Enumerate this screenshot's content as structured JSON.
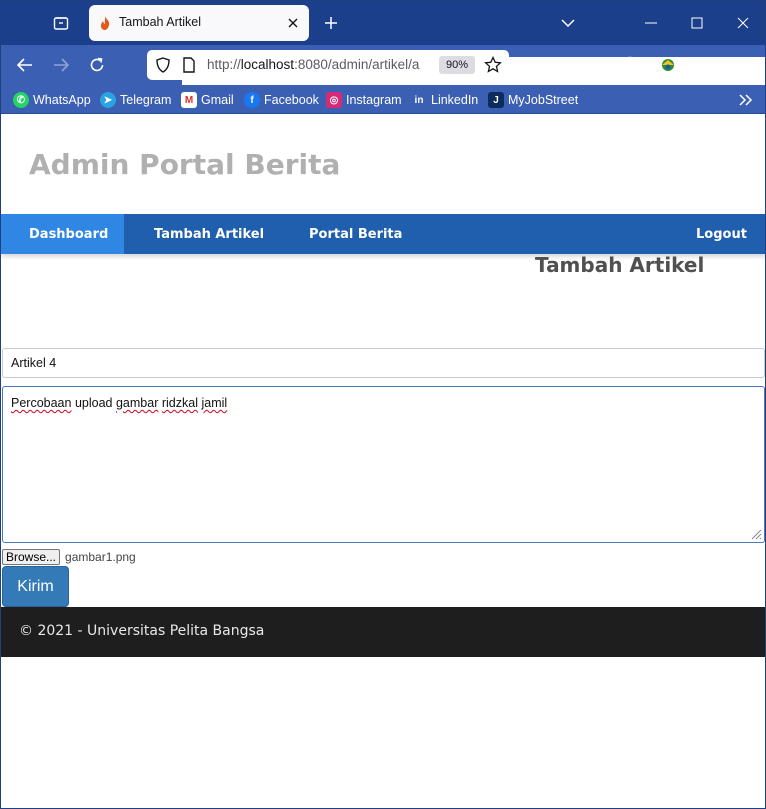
{
  "browser": {
    "tab_title": "Tambah Artikel",
    "url_scheme": "http://",
    "url_host": "localhost",
    "url_rest": ":8080/admin/artikel/a",
    "zoom": "90%",
    "colors": {
      "tabbar": "#1c3f8c",
      "toolbar": "#3b5fb2"
    }
  },
  "bookmarks": [
    {
      "label": "WhatsApp",
      "icon": "whatsapp-icon"
    },
    {
      "label": "Telegram",
      "icon": "telegram-icon"
    },
    {
      "label": "Gmail",
      "icon": "gmail-icon"
    },
    {
      "label": "Facebook",
      "icon": "facebook-icon"
    },
    {
      "label": "Instagram",
      "icon": "instagram-icon"
    },
    {
      "label": "LinkedIn",
      "icon": "linkedin-icon"
    },
    {
      "label": "MyJobStreet",
      "icon": "myjobstreet-icon"
    }
  ],
  "site": {
    "title": "Admin Portal Berita",
    "nav": {
      "dashboard": "Dashboard",
      "tambah_artikel": "Tambah Artikel",
      "portal_berita": "Portal Berita",
      "logout": "Logout"
    },
    "active_nav": "Dashboard",
    "colors": {
      "nav": "#1f5fae",
      "nav_active": "#2f86e3",
      "button": "#337ab7",
      "footer": "#1e1e1e"
    }
  },
  "form": {
    "heading": "Tambah Artikel",
    "judul_value": "Artikel 4",
    "isi_words": [
      "Percobaan",
      "upload",
      "gambar",
      "ridzkal",
      "jamil"
    ],
    "browse_label": "Browse...",
    "file_name": "gambar1.png",
    "submit_label": "Kirim"
  },
  "footer": {
    "text": "© 2021 - Universitas Pelita Bangsa"
  }
}
